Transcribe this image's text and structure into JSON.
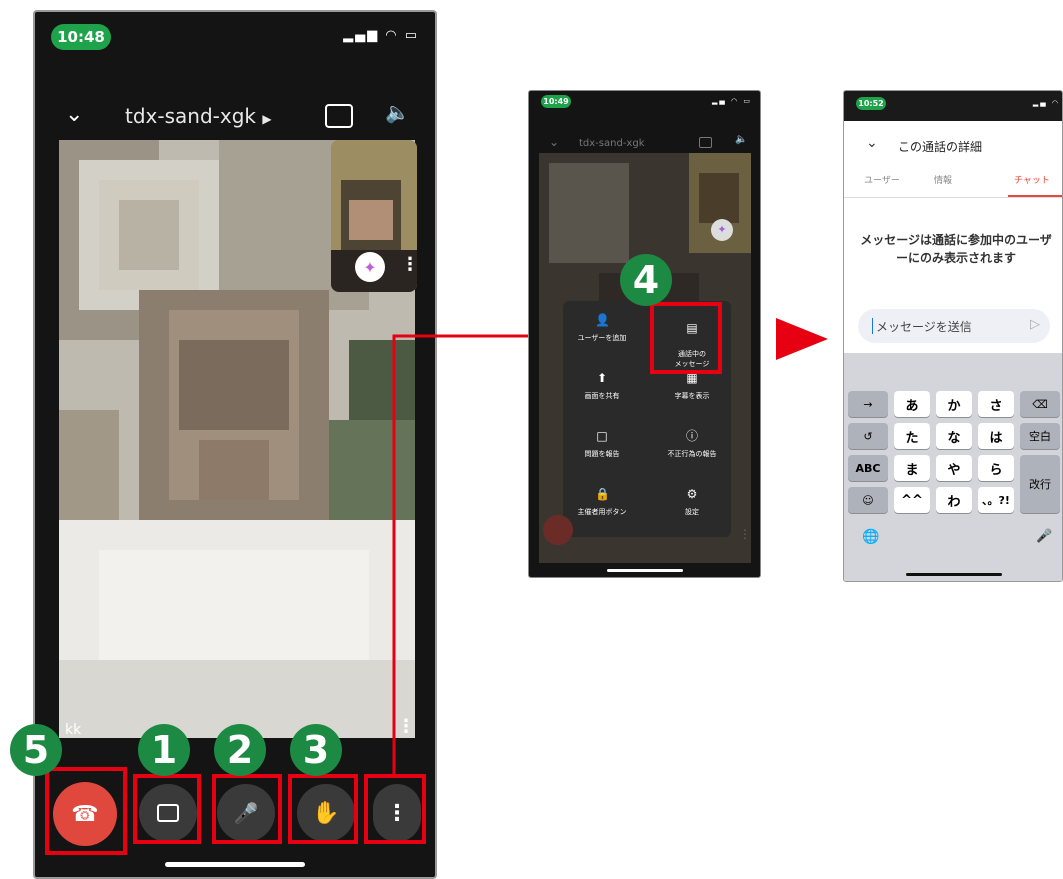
{
  "call": {
    "time": "10:48",
    "meeting_code": "tdx-sand-xgk",
    "participant_name": "kk",
    "status_icons": "▂▄▆ ◠ ▭"
  },
  "menu_screen": {
    "time": "10:49",
    "meeting_code": "tdx-sand-xgk",
    "menu_items": [
      {
        "label": "ユーザーを追加",
        "icon": "person-add-icon"
      },
      {
        "label": "通話中の\nメッセージ",
        "icon": "chat-icon"
      },
      {
        "label": "画面を共有",
        "icon": "present-icon"
      },
      {
        "label": "字幕を表示",
        "icon": "captions-icon"
      },
      {
        "label": "問題を報告",
        "icon": "feedback-icon"
      },
      {
        "label": "不正行為の報告",
        "icon": "report-icon"
      },
      {
        "label": "主催者用ボタン",
        "icon": "host-lock-icon"
      },
      {
        "label": "設定",
        "icon": "gear-icon"
      }
    ]
  },
  "chat_screen": {
    "time": "10:52",
    "header_title": "この通話の詳細",
    "tabs": [
      "ユーザー",
      "情報",
      "チャット"
    ],
    "active_tab": "チャット",
    "notice": "メッセージは通話に参加中のユーザーにのみ表示されます",
    "input_placeholder": "メッセージを送信",
    "keyboard": {
      "row1": [
        "→",
        "あ",
        "か",
        "さ",
        "⌫"
      ],
      "row2": [
        "↺",
        "た",
        "な",
        "は",
        "空白"
      ],
      "row3": [
        "ABC",
        "ま",
        "や",
        "ら",
        "改行"
      ],
      "row4": [
        "☺",
        "^^",
        "わ",
        "、。?!"
      ]
    }
  },
  "callouts": [
    "1",
    "2",
    "3",
    "4",
    "5"
  ],
  "colors": {
    "accent_red": "#e60012",
    "badge_green": "#1c8a43",
    "end_call_red": "#e0473d",
    "chat_tab_red": "#e8473b"
  }
}
